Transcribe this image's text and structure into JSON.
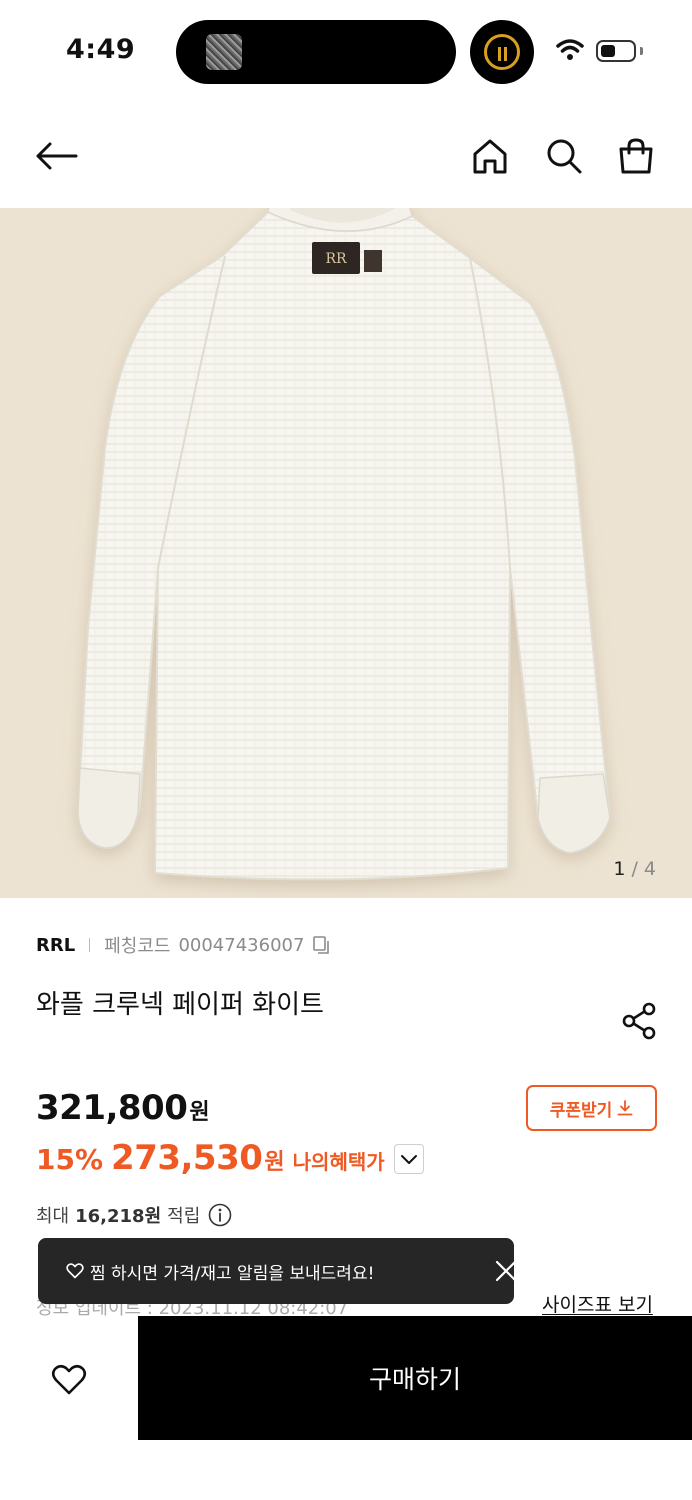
{
  "status_bar": {
    "time": "4:49"
  },
  "gallery": {
    "current": "1",
    "separator": "/",
    "total": "4"
  },
  "product": {
    "brand": "RRL",
    "code_label": "페칭코드",
    "code_value": "00047436007",
    "title": "와플 크루넥 페이퍼 화이트",
    "price_original": "321,800",
    "currency": "원",
    "coupon_label": "쿠폰받기",
    "discount_pct": "15%",
    "price_sale": "273,530",
    "benefit_label": "나의혜택가",
    "points_prefix": "최대",
    "points_amount": "16,218원",
    "points_suffix": "적립",
    "updated_text": "정보 업데이트 : 2023.11.12 08:42:07",
    "size_chart_label": "사이즈표 보기"
  },
  "toast": {
    "message": "찜 하시면 가격/재고 알림을 보내드려요!"
  },
  "bottom_bar": {
    "buy_label": "구매하기"
  },
  "colors": {
    "accent": "#ef5a24",
    "image_bg": "#ede3d2",
    "toast_bg": "#262626"
  }
}
